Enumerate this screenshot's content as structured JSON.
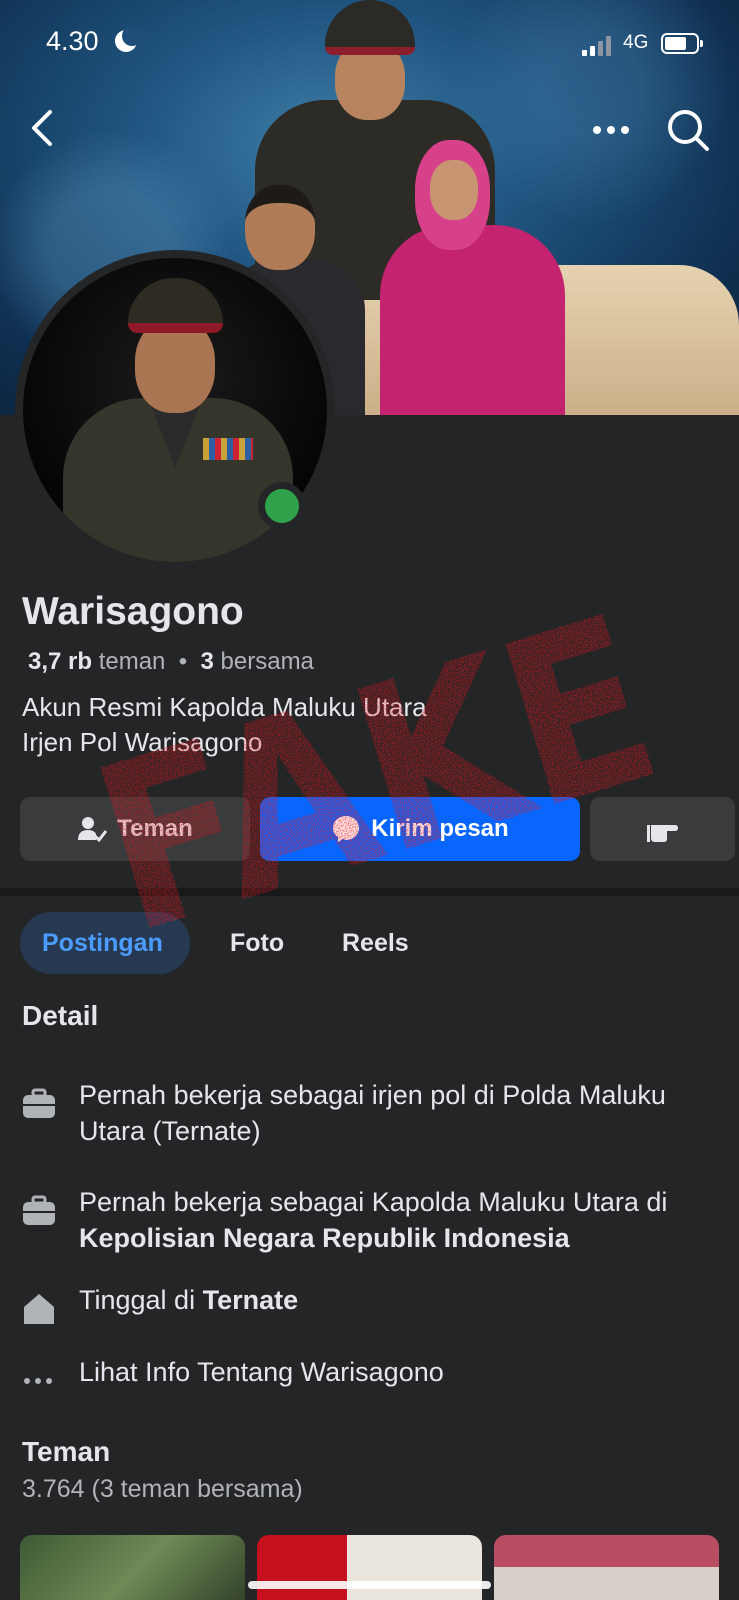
{
  "status_bar": {
    "time": "4.30",
    "network": "4G",
    "battery_level": 0.7,
    "signal_level": 0.5
  },
  "nav": {
    "back_icon": "chevron-left-icon",
    "more_icon": "more-horizontal-icon",
    "search_icon": "search-icon"
  },
  "profile": {
    "name": "Warisagono",
    "stats": {
      "friends_count": "3,7 rb",
      "friends_label": "teman",
      "separator": "•",
      "mutual_count": "3",
      "mutual_label": "bersama"
    },
    "bio_line1": "Akun Resmi Kapolda Maluku Utara",
    "bio_line2": "Irjen Pol Warisagono",
    "online": true
  },
  "actions": {
    "friends_label": "Teman",
    "message_label": "Kirim pesan"
  },
  "tabs": [
    {
      "label": "Postingan",
      "active": true
    },
    {
      "label": "Foto",
      "active": false
    },
    {
      "label": "Reels",
      "active": false
    }
  ],
  "detail": {
    "title": "Detail",
    "items": [
      {
        "icon": "briefcase-icon",
        "text": "Pernah bekerja sebagai  irjen pol di Polda Maluku Utara (Ternate)",
        "bold": ""
      },
      {
        "icon": "briefcase-icon",
        "text": "Pernah bekerja sebagai  Kapolda Maluku Utara di ",
        "bold": "Kepolisian Negara Republik Indonesia"
      },
      {
        "icon": "home-icon",
        "text": "Tinggal di ",
        "bold": "Ternate"
      },
      {
        "icon": "more-horizontal-icon",
        "text": "Lihat Info Tentang Warisagono",
        "bold": ""
      }
    ]
  },
  "friends": {
    "title": "Teman",
    "count_text": "3.764 (3 teman bersama)"
  },
  "overlay": {
    "stamp_text": "FAKE",
    "stamp_color": "#e3161f"
  },
  "colors": {
    "background": "#242526",
    "accent": "#0866ff",
    "online": "#31a24c",
    "text": "#e4e6eb",
    "muted": "#b0b3b8"
  }
}
